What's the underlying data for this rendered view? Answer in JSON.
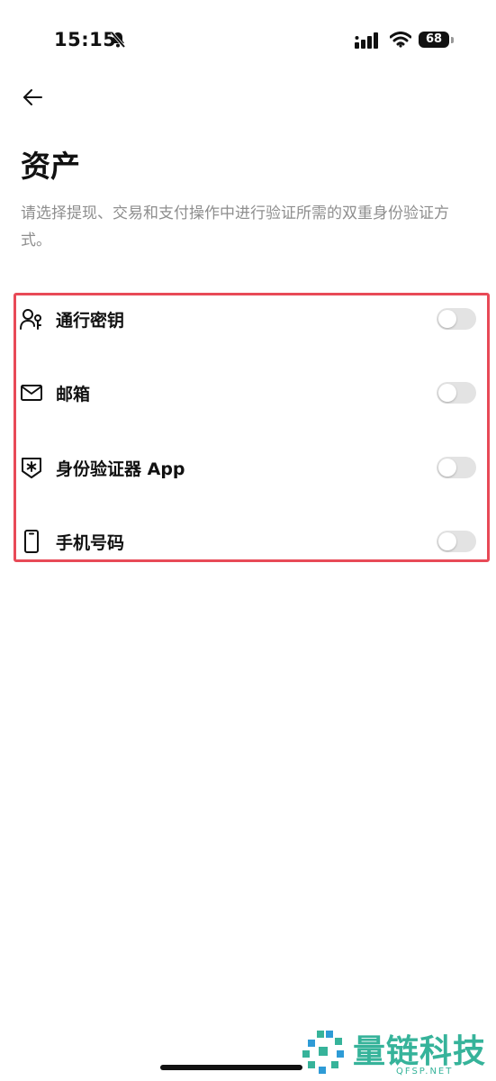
{
  "status_bar": {
    "time": "15:15",
    "battery": "68",
    "icons": [
      "bell-slash-icon",
      "signal-icon",
      "wifi-icon",
      "battery-icon"
    ]
  },
  "header": {
    "back_icon": "arrow-left-icon",
    "title": "资产",
    "description": "请选择提现、交易和支付操作中进行验证所需的双重身份验证方式。"
  },
  "options": [
    {
      "label": "通行密钥",
      "icon": "passkey-icon",
      "enabled": false
    },
    {
      "label": "邮箱",
      "icon": "mail-icon",
      "enabled": false
    },
    {
      "label": "身份验证器 App",
      "icon": "authenticator-icon",
      "enabled": false
    },
    {
      "label": "手机号码",
      "icon": "phone-icon",
      "enabled": false
    }
  ],
  "watermark": {
    "text": "量链科技",
    "sub": "QFSP.NET"
  },
  "colors": {
    "highlight_border": "#e84a57",
    "toggle_off": "#e3e3e3",
    "description_text": "#8e8e8e",
    "watermark": "#36b39a"
  }
}
